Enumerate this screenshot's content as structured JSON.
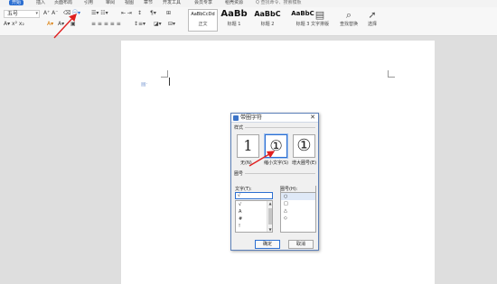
{
  "menubar": {
    "tabs": [
      "开始",
      "插入",
      "页面布局",
      "引用",
      "审阅",
      "视图",
      "章节",
      "开发工具",
      "会员专享",
      "稻壳资源"
    ],
    "search_placeholder": "Q 查找命令、搜索模板"
  },
  "ribbon": {
    "font_size": "五号",
    "styles": [
      {
        "sample": "AaBbCcDd",
        "label": "正文"
      },
      {
        "sample": "AaBb",
        "label": "标题 1"
      },
      {
        "sample": "AaBbC",
        "label": "标题 2"
      },
      {
        "sample": "AaBbC",
        "label": "标题 3"
      }
    ],
    "text_layout_label": "文字排版",
    "find_replace_label": "查找替换",
    "select_label": "选择"
  },
  "dialog": {
    "title": "带圈字符",
    "style_section": "样式",
    "options": [
      {
        "glyph": "1",
        "label": "无(N)"
      },
      {
        "glyph": "①",
        "label": "缩小文字(S)"
      },
      {
        "glyph": "①",
        "label": "增大圈号(E)"
      }
    ],
    "enclosure_section": "圈号",
    "text_label": "文字(T):",
    "enclosure_label": "圈号(H):",
    "text_value": "√",
    "text_list": [
      "√",
      "A",
      "#",
      "!"
    ],
    "enclosure_list": [
      "○",
      "□",
      "△",
      "◇"
    ],
    "ok_label": "确定",
    "cancel_label": "取消"
  },
  "colors": {
    "accent": "#2c6fd1",
    "annotation_arrow": "#e02020"
  }
}
